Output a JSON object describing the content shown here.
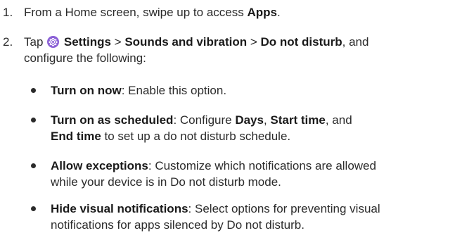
{
  "steps": [
    {
      "number": "1.",
      "text_before": "From a Home screen, swipe up to access ",
      "bold": "Apps",
      "text_after": "."
    },
    {
      "number": "2.",
      "tap": "Tap",
      "settings": "Settings",
      "sep1": " > ",
      "sounds": "Sounds and vibration",
      "sep2": " > ",
      "dnd": "Do not disturb",
      "line1_rest": ", and",
      "line2": "configure the following:"
    }
  ],
  "bullets": [
    {
      "title": "Turn on now",
      "line1": ": Enable this option."
    },
    {
      "title": "Turn on as scheduled",
      "line1_a": ": Configure ",
      "days": "Days",
      "comma1": ", ",
      "start": "Start time",
      "line1_b": ", and",
      "end": "End time",
      "line2_rest": " to set up a do not disturb schedule."
    },
    {
      "title": "Allow exceptions",
      "line1": ": Customize which notifications are allowed",
      "line2": "while your device is in Do not disturb mode."
    },
    {
      "title": "Hide visual notifications",
      "line1": ": Select options for preventing visual",
      "line2": "notifications for apps silenced by Do not disturb."
    }
  ],
  "colors": {
    "text": "#2b2b2b",
    "settings_icon": "#8a5fd6"
  },
  "icons": {
    "settings": "gear-icon"
  }
}
